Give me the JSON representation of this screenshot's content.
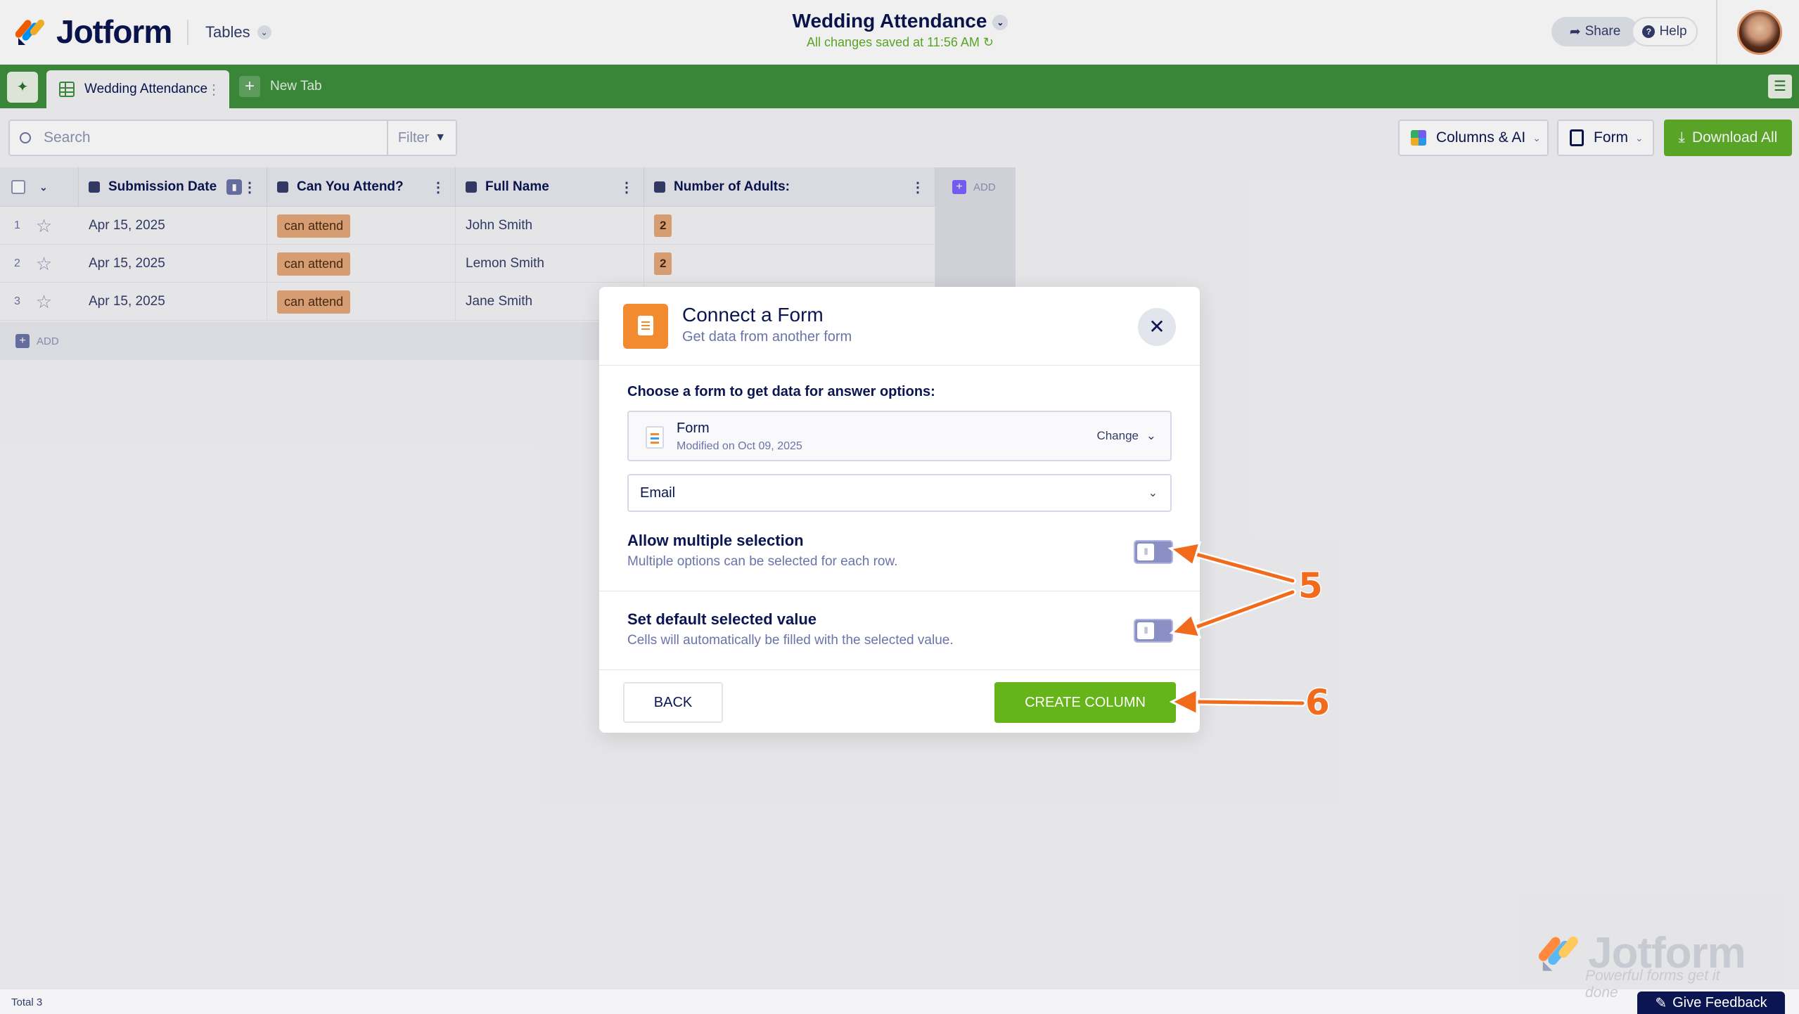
{
  "header": {
    "brand": "Jotform",
    "tables_label": "Tables",
    "doc_title": "Wedding Attendance",
    "saved_status": "All changes saved at 11:56 AM",
    "share_label": "Share",
    "help_label": "Help"
  },
  "tabs": {
    "active_tab": "Wedding Attendance",
    "new_tab_label": "New Tab"
  },
  "toolbar": {
    "search_placeholder": "Search",
    "filter_label": "Filter",
    "columns_label": "Columns & AI",
    "form_label": "Form",
    "download_label": "Download All"
  },
  "table": {
    "columns": [
      "Submission Date",
      "Can You Attend?",
      "Full Name",
      "Number of Adults:"
    ],
    "add_col_label": "ADD",
    "rows": [
      {
        "num": "1",
        "date": "Apr 15, 2025",
        "attend": "can attend",
        "name": "John Smith",
        "adults": "2"
      },
      {
        "num": "2",
        "date": "Apr 15, 2025",
        "attend": "can attend",
        "name": "Lemon Smith",
        "adults": "2"
      },
      {
        "num": "3",
        "date": "Apr 15, 2025",
        "attend": "can attend",
        "name": "Jane Smith",
        "adults": ""
      }
    ],
    "add_row_label": "ADD"
  },
  "modal": {
    "title": "Connect a Form",
    "subtitle": "Get data from another form",
    "choose_label": "Choose a form to get data for answer options:",
    "form_name": "Form",
    "form_modified": "Modified on Oct 09, 2025",
    "change_label": "Change",
    "field_value": "Email",
    "option1_title": "Allow multiple selection",
    "option1_desc": "Multiple options can be selected for each row.",
    "option1_enabled": false,
    "option2_title": "Set default selected value",
    "option2_desc": "Cells will automatically be filled with the selected value.",
    "option2_enabled": false,
    "back_label": "BACK",
    "create_label": "CREATE COLUMN"
  },
  "annotations": {
    "step5": "5",
    "step6": "6",
    "arrow_color": "#f26a1b"
  },
  "footer": {
    "total_label": "Total 3",
    "watermark_name": "Jotform",
    "watermark_tagline": "Powerful forms get it done",
    "feedback_label": "Give Feedback"
  },
  "colors": {
    "brand_navy": "#0a1551",
    "tab_green": "#3d8f3d",
    "button_green": "#64b41a",
    "form_orange": "#f28b30",
    "tag_peach": "#e4a77a"
  }
}
